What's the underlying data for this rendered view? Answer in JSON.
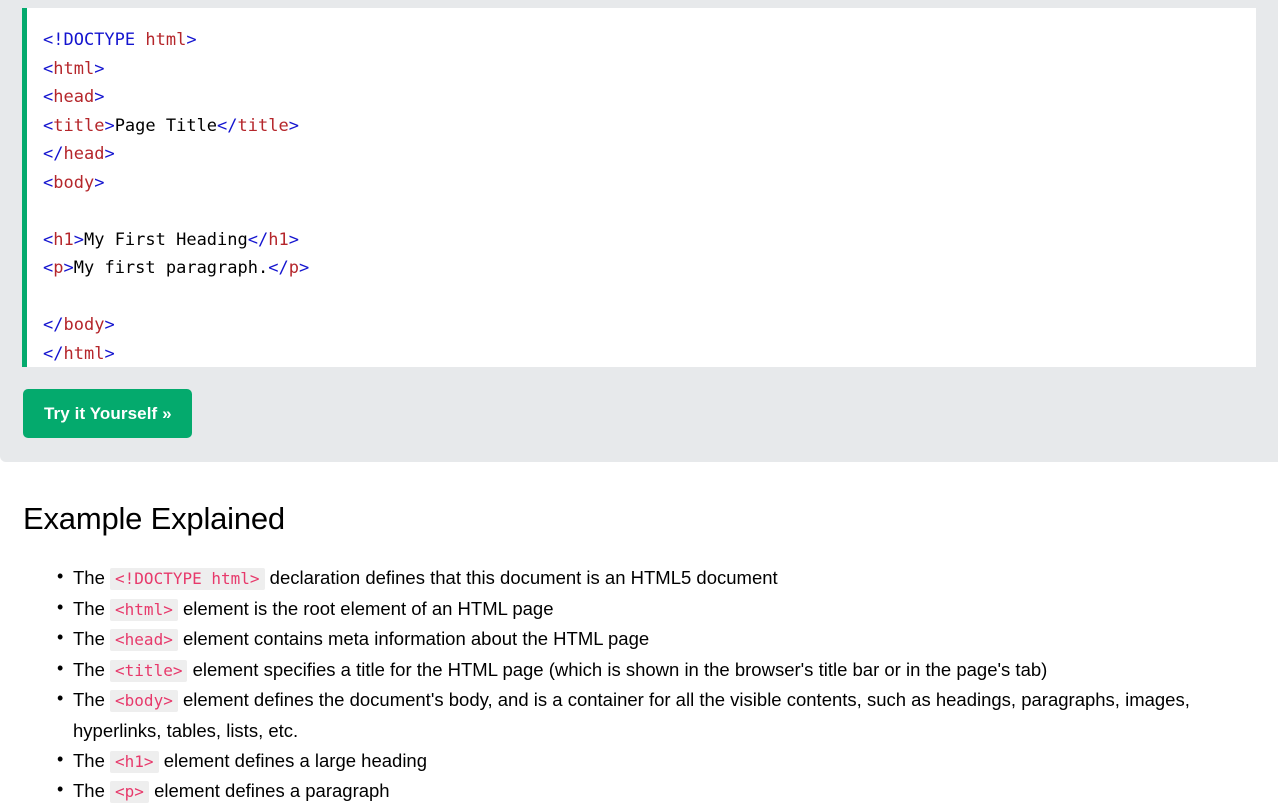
{
  "colors": {
    "accent_green": "#04AA6D",
    "example_bg": "#e7e9eb",
    "code_bg": "#ffffff",
    "inline_code_text": "#e7396b",
    "inline_code_bg": "#eeeeee",
    "tag_bracket": "#1414cf",
    "tag_name": "#b5262b"
  },
  "example": {
    "code_lines": [
      {
        "tokens": [
          {
            "t": "br",
            "v": "<!DOCTYPE "
          },
          {
            "t": "tg",
            "v": "html"
          },
          {
            "t": "br",
            "v": ">"
          }
        ]
      },
      {
        "tokens": [
          {
            "t": "br",
            "v": "<"
          },
          {
            "t": "tg",
            "v": "html"
          },
          {
            "t": "br",
            "v": ">"
          }
        ]
      },
      {
        "tokens": [
          {
            "t": "br",
            "v": "<"
          },
          {
            "t": "tg",
            "v": "head"
          },
          {
            "t": "br",
            "v": ">"
          }
        ]
      },
      {
        "tokens": [
          {
            "t": "br",
            "v": "<"
          },
          {
            "t": "tg",
            "v": "title"
          },
          {
            "t": "br",
            "v": ">"
          },
          {
            "t": "tx",
            "v": "Page Title"
          },
          {
            "t": "br",
            "v": "</"
          },
          {
            "t": "tg",
            "v": "title"
          },
          {
            "t": "br",
            "v": ">"
          }
        ]
      },
      {
        "tokens": [
          {
            "t": "br",
            "v": "</"
          },
          {
            "t": "tg",
            "v": "head"
          },
          {
            "t": "br",
            "v": ">"
          }
        ]
      },
      {
        "tokens": [
          {
            "t": "br",
            "v": "<"
          },
          {
            "t": "tg",
            "v": "body"
          },
          {
            "t": "br",
            "v": ">"
          }
        ]
      },
      {
        "tokens": []
      },
      {
        "tokens": [
          {
            "t": "br",
            "v": "<"
          },
          {
            "t": "tg",
            "v": "h1"
          },
          {
            "t": "br",
            "v": ">"
          },
          {
            "t": "tx",
            "v": "My First Heading"
          },
          {
            "t": "br",
            "v": "</"
          },
          {
            "t": "tg",
            "v": "h1"
          },
          {
            "t": "br",
            "v": ">"
          }
        ]
      },
      {
        "tokens": [
          {
            "t": "br",
            "v": "<"
          },
          {
            "t": "tg",
            "v": "p"
          },
          {
            "t": "br",
            "v": ">"
          },
          {
            "t": "tx",
            "v": "My first paragraph."
          },
          {
            "t": "br",
            "v": "</"
          },
          {
            "t": "tg",
            "v": "p"
          },
          {
            "t": "br",
            "v": ">"
          }
        ]
      },
      {
        "tokens": []
      },
      {
        "tokens": [
          {
            "t": "br",
            "v": "</"
          },
          {
            "t": "tg",
            "v": "body"
          },
          {
            "t": "br",
            "v": ">"
          }
        ]
      },
      {
        "tokens": [
          {
            "t": "br",
            "v": "</"
          },
          {
            "t": "tg",
            "v": "html"
          },
          {
            "t": "br",
            "v": ">"
          }
        ]
      }
    ],
    "tryit_label": "Try it Yourself »"
  },
  "explained": {
    "title": "Example Explained",
    "items": [
      {
        "before": "The ",
        "code": "<!DOCTYPE html>",
        "after": " declaration defines that this document is an HTML5 document"
      },
      {
        "before": "The ",
        "code": "<html>",
        "after": " element is the root element of an HTML page"
      },
      {
        "before": "The ",
        "code": "<head>",
        "after": " element contains meta information about the HTML page"
      },
      {
        "before": "The ",
        "code": "<title>",
        "after": " element specifies a title for the HTML page (which is shown in the browser's title bar or in the page's tab)"
      },
      {
        "before": "The ",
        "code": "<body>",
        "after": " element defines the document's body, and is a container for all the visible contents, such as headings, paragraphs, images, hyperlinks, tables, lists, etc."
      },
      {
        "before": "The ",
        "code": "<h1>",
        "after": " element defines a large heading"
      },
      {
        "before": "The ",
        "code": "<p>",
        "after": " element defines a paragraph"
      }
    ]
  }
}
